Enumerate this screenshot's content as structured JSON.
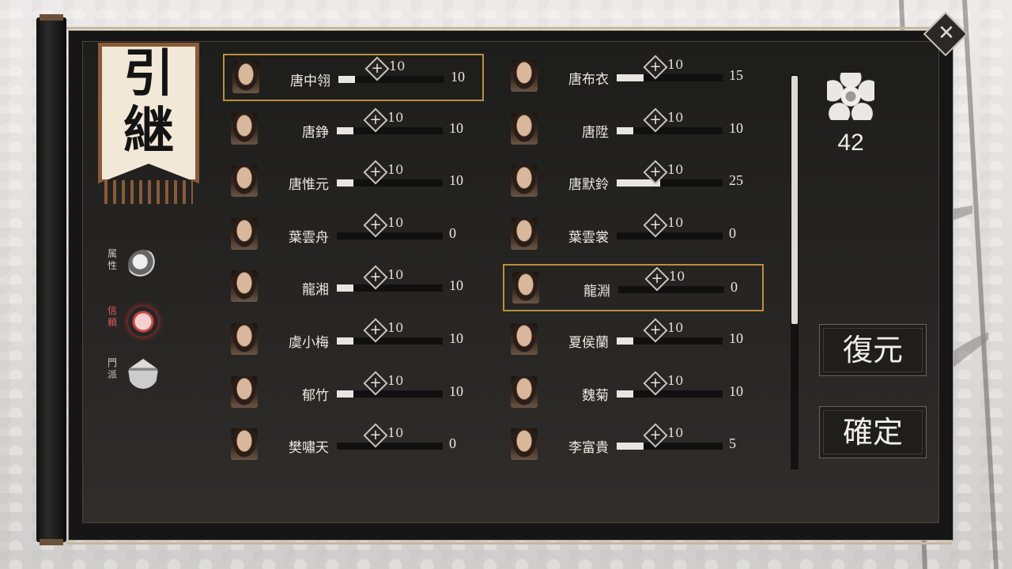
{
  "banner": {
    "title": "引\n継"
  },
  "side_tabs": [
    {
      "label": "属性",
      "icon": "yin-yang-icon",
      "active": false
    },
    {
      "label": "信頼",
      "icon": "trust-icon",
      "active": true
    },
    {
      "label": "門派",
      "icon": "sect-temple-icon",
      "active": false
    }
  ],
  "characters_left": [
    {
      "name": "唐中翎",
      "cost": "10",
      "value": "10",
      "fill": 0.16,
      "selected": true
    },
    {
      "name": "唐錚",
      "cost": "10",
      "value": "10",
      "fill": 0.16,
      "selected": false
    },
    {
      "name": "唐惟元",
      "cost": "10",
      "value": "10",
      "fill": 0.16,
      "selected": false
    },
    {
      "name": "葉雲舟",
      "cost": "10",
      "value": "0",
      "fill": 0.0,
      "selected": false
    },
    {
      "name": "龍湘",
      "cost": "10",
      "value": "10",
      "fill": 0.16,
      "selected": false
    },
    {
      "name": "虞小梅",
      "cost": "10",
      "value": "10",
      "fill": 0.16,
      "selected": false
    },
    {
      "name": "郁竹",
      "cost": "10",
      "value": "10",
      "fill": 0.16,
      "selected": false
    },
    {
      "name": "樊嘯天",
      "cost": "10",
      "value": "0",
      "fill": 0.0,
      "selected": false
    }
  ],
  "characters_right": [
    {
      "name": "唐布衣",
      "cost": "10",
      "value": "15",
      "fill": 0.25,
      "selected": false
    },
    {
      "name": "唐陞",
      "cost": "10",
      "value": "10",
      "fill": 0.16,
      "selected": false
    },
    {
      "name": "唐默鈴",
      "cost": "10",
      "value": "25",
      "fill": 0.41,
      "selected": false
    },
    {
      "name": "葉雲裳",
      "cost": "10",
      "value": "0",
      "fill": 0.0,
      "selected": false
    },
    {
      "name": "龍淵",
      "cost": "10",
      "value": "0",
      "fill": 0.0,
      "selected": true
    },
    {
      "name": "夏侯蘭",
      "cost": "10",
      "value": "10",
      "fill": 0.16,
      "selected": false
    },
    {
      "name": "魏菊",
      "cost": "10",
      "value": "10",
      "fill": 0.16,
      "selected": false
    },
    {
      "name": "李富貴",
      "cost": "10",
      "value": "5",
      "fill": 0.25,
      "selected": false
    }
  ],
  "points": {
    "icon": "plum-flower-icon",
    "value": "42"
  },
  "buttons": {
    "reset_label": "復元",
    "confirm_label": "確定"
  },
  "close_icon": "close-icon"
}
